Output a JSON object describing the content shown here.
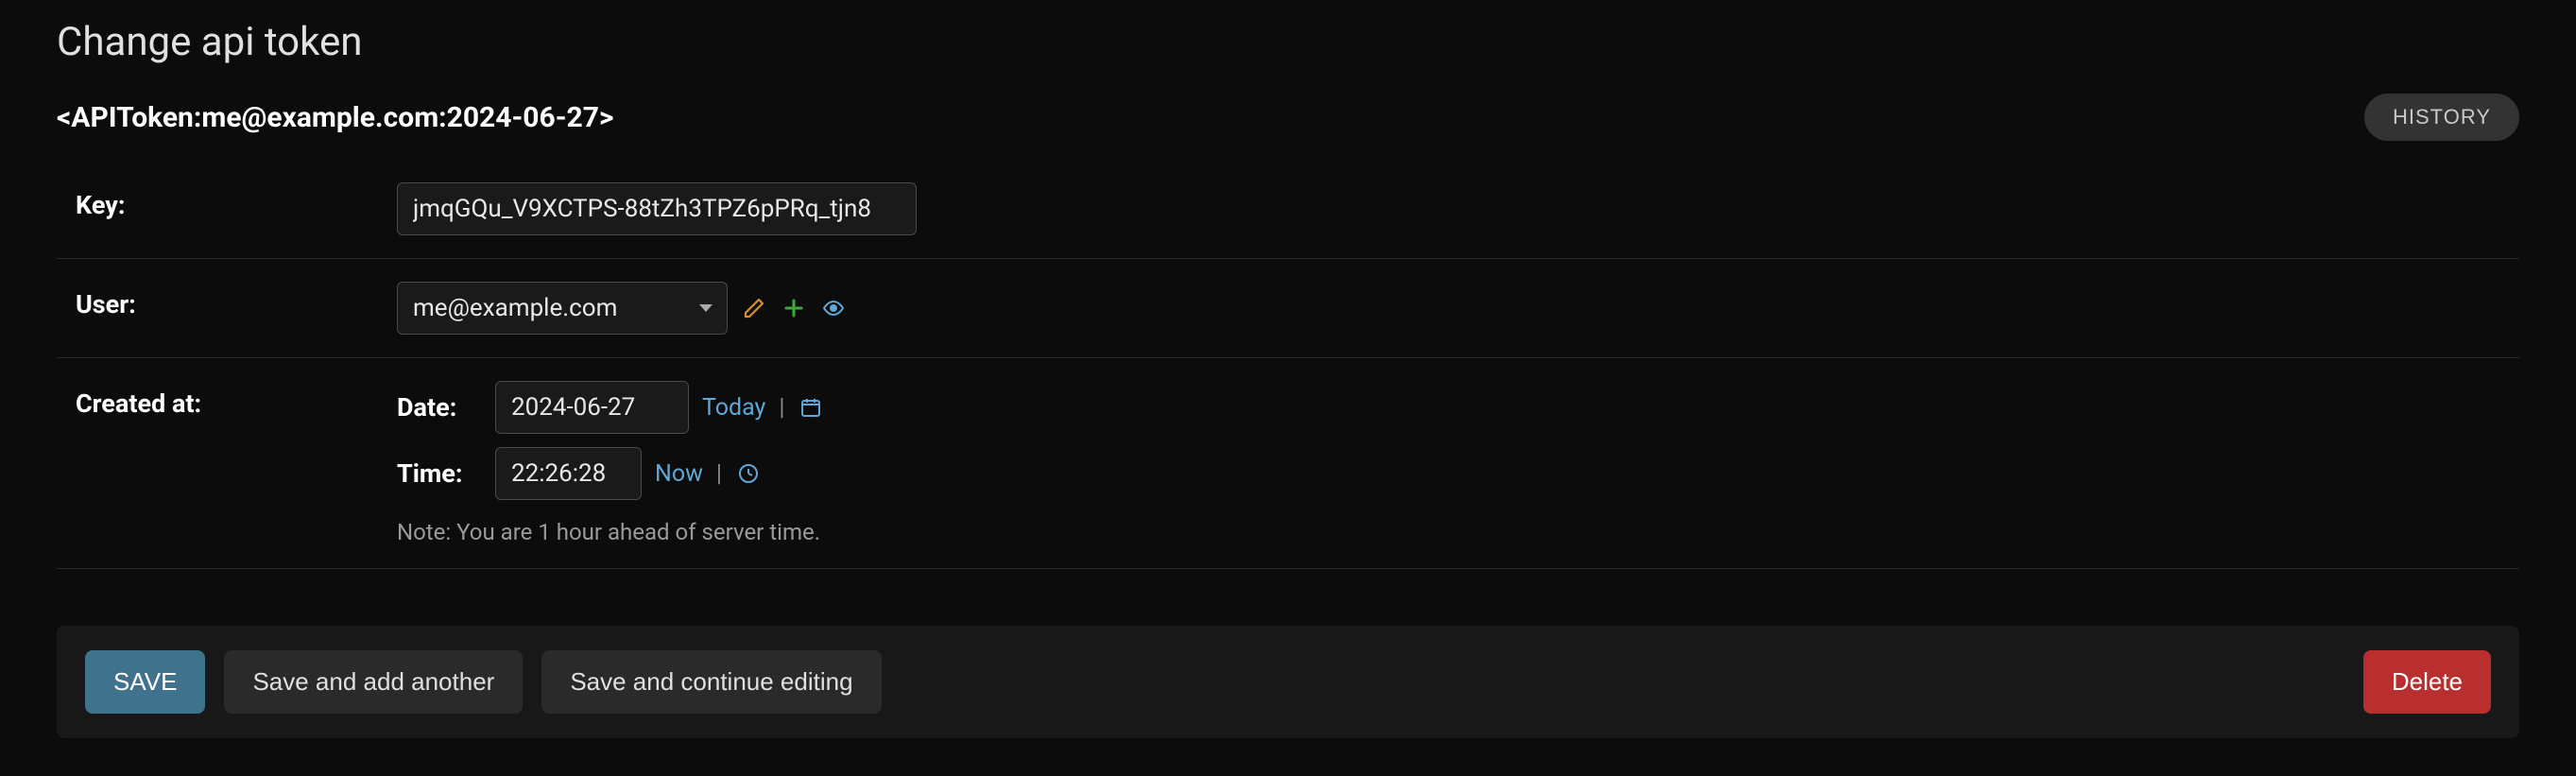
{
  "page": {
    "title": "Change api token",
    "object_repr": "<APIToken:me@example.com:2024-06-27>",
    "history_label": "HISTORY"
  },
  "fields": {
    "key": {
      "label": "Key:",
      "value": "jmqGQu_V9XCTPS-88tZh3TPZ6pPRq_tjn8"
    },
    "user": {
      "label": "User:",
      "selected": "me@example.com",
      "options": [
        "me@example.com"
      ]
    },
    "created_at": {
      "label": "Created at:",
      "date_label": "Date:",
      "date_value": "2024-06-27",
      "today_label": "Today",
      "time_label": "Time:",
      "time_value": "22:26:28",
      "now_label": "Now",
      "note": "Note: You are 1 hour ahead of server time."
    }
  },
  "buttons": {
    "save": "SAVE",
    "save_add": "Save and add another",
    "save_continue": "Save and continue editing",
    "delete": "Delete"
  },
  "icons": {
    "pencil": "pencil-icon",
    "plus": "plus-icon",
    "eye": "eye-icon",
    "calendar": "calendar-icon",
    "clock": "clock-icon"
  }
}
